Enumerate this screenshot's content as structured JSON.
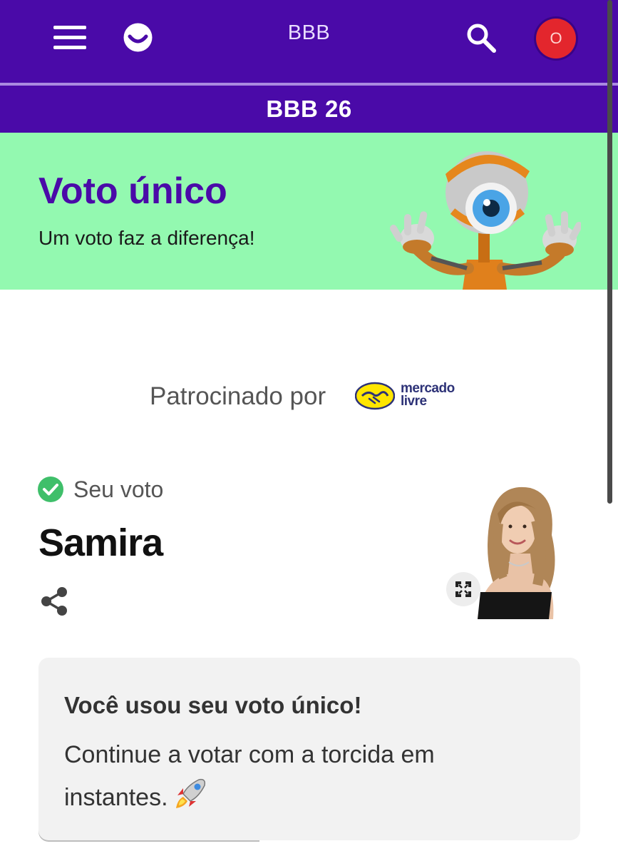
{
  "header": {
    "title": "BBB",
    "menu_icon": "hamburger-menu-icon",
    "logo_icon": "smile-logo-icon",
    "search_icon": "search-icon",
    "avatar_initial": "O",
    "subtitle": "BBB 26"
  },
  "hero": {
    "title": "Voto único",
    "subtitle": "Um voto faz a diferença!",
    "mascot": "big-brother-eye-mascot"
  },
  "sponsor": {
    "label": "Patrocinado por",
    "brand_line1": "mercado",
    "brand_line2": "livre"
  },
  "vote": {
    "status_label": "Seu voto",
    "candidate_name": "Samira",
    "share_icon": "share-icon",
    "expand_icon": "expand-icon"
  },
  "info_card": {
    "title": "Você usou seu voto único!",
    "body": "Continue a votar com a torcida em instantes.",
    "emoji": "🚀"
  },
  "colors": {
    "brand_purple": "#4a0aa8",
    "hero_green": "#93f9b0",
    "avatar_red": "#e3262d",
    "check_green": "#3fbf6a"
  }
}
